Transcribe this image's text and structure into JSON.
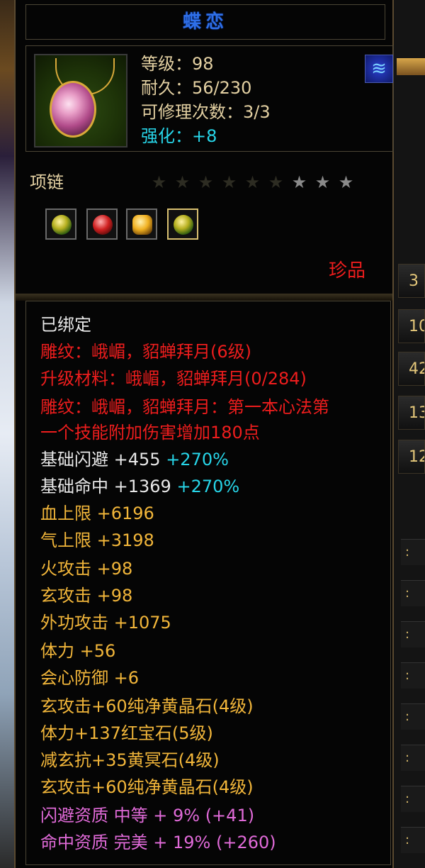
{
  "item": {
    "name": "蝶恋",
    "level": "等级：98",
    "durability": "耐久：56/230",
    "repair": "可修理次数：3/3",
    "enhance": "强化：+8",
    "type": "项链",
    "stars": {
      "total": 9,
      "lit": 3
    },
    "rarity": "珍品"
  },
  "sockets": [
    {
      "gem": "green-gem-icon",
      "color": "#b7b020"
    },
    {
      "gem": "red-gem-icon",
      "color": "#d02020"
    },
    {
      "gem": "yellow-gem-icon",
      "color": "#f0b020"
    },
    {
      "gem": "green-gem-icon",
      "color": "#b7b020",
      "selected": true
    }
  ],
  "details": {
    "bound": "已绑定",
    "engrave1": "雕纹：峨嵋，貂蝉拜月(6级)",
    "upgrade": "升级材料：峨嵋，貂蝉拜月(0/284)",
    "engrave2a": "雕纹：峨嵋，貂蝉拜月：第一本心法第",
    "engrave2b": "一个技能附加伤害增加180点",
    "base_dodge": "基础闪避  +455",
    "base_dodge_pct": "+270%",
    "base_hit": "基础命中  +1369",
    "base_hit_pct": "+270%",
    "hp": "血上限  +6196",
    "qi": "气上限  +3198",
    "fire_atk": "火攻击  +98",
    "xuan_atk": "玄攻击  +98",
    "ext_atk": "外功攻击  +1075",
    "stamina": "体力  +56",
    "crit_def": "会心防御  +6",
    "gem1": "玄攻击+60纯净黄晶石(4级)",
    "gem2": "体力+137红宝石(5级)",
    "gem3": "减玄抗+35黄冥石(4级)",
    "gem4": "玄攻击+60纯净黄晶石(4级)",
    "apt_dodge": "闪避资质  中等  +  9%  (+41)",
    "apt_hit": "命中资质  完美  +  19%  (+260)"
  },
  "side": {
    "values": [
      "3",
      "10",
      "42",
      "13",
      "12"
    ]
  }
}
